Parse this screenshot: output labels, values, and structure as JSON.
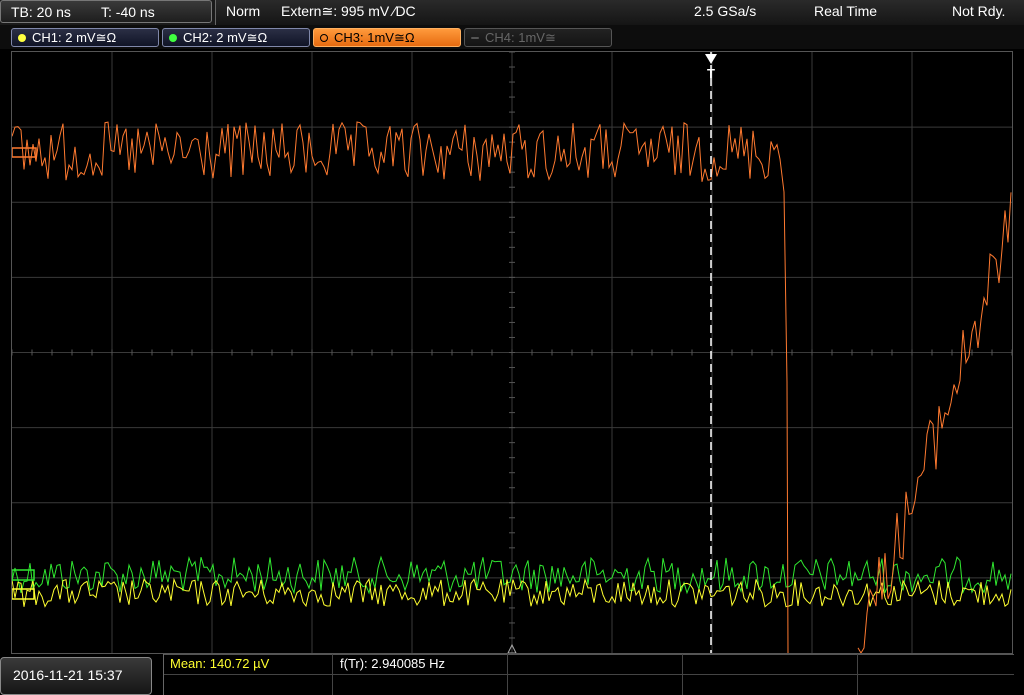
{
  "header": {
    "timebase": "TB: 20 ns",
    "trigger_time": "T: -40 ns",
    "mode": "Norm",
    "trigger_source": "Extern≅: 995 mV ∕DC",
    "sample_rate": "2.5 GSa/s",
    "acq_mode": "Real Time",
    "status": "Not Rdy."
  },
  "channels": [
    {
      "label": "CH1: 2 mV≅Ω",
      "color": "#ffff40",
      "state": "on"
    },
    {
      "label": "CH2: 2 mV≅Ω",
      "color": "#40ff40",
      "state": "on"
    },
    {
      "label": "CH3: 1mV≅Ω",
      "color": "#ff8030",
      "state": "active"
    },
    {
      "label": "CH4: 1mV≅",
      "color": "#666666",
      "state": "off"
    }
  ],
  "trigger_marker": "T",
  "footer": {
    "datetime": "2016-11-21 15:37",
    "mean_label": "Mean: 140.72 µV",
    "freq_label": "f(Tr): 2.940085 Hz"
  },
  "colors": {
    "ch1": "#ffff30",
    "ch2": "#30e830",
    "ch3": "#ff7a30",
    "grid": "#3a3a3a",
    "mean_text": "#ffff30"
  }
}
